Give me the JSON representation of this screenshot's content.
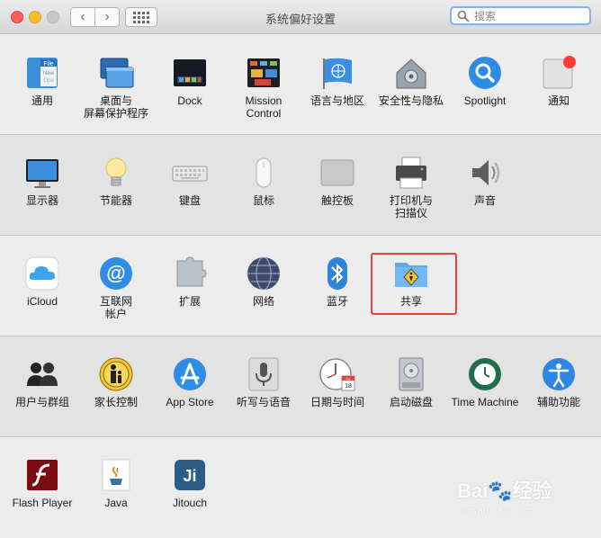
{
  "window": {
    "title": "系统偏好设置"
  },
  "search": {
    "placeholder": "搜索",
    "value": ""
  },
  "rows": [
    {
      "items": [
        {
          "label": "通用",
          "icon": "general-icon"
        },
        {
          "label": "桌面与\n屏幕保护程序",
          "icon": "desktop-screensaver-icon"
        },
        {
          "label": "Dock",
          "icon": "dock-icon"
        },
        {
          "label": "Mission\nControl",
          "icon": "mission-control-icon"
        },
        {
          "label": "语言与地区",
          "icon": "language-region-icon"
        },
        {
          "label": "安全性与隐私",
          "icon": "security-privacy-icon"
        },
        {
          "label": "Spotlight",
          "icon": "spotlight-icon"
        },
        {
          "label": "通知",
          "icon": "notifications-icon"
        }
      ]
    },
    {
      "items": [
        {
          "label": "显示器",
          "icon": "displays-icon"
        },
        {
          "label": "节能器",
          "icon": "energy-saver-icon"
        },
        {
          "label": "键盘",
          "icon": "keyboard-icon"
        },
        {
          "label": "鼠标",
          "icon": "mouse-icon"
        },
        {
          "label": "触控板",
          "icon": "trackpad-icon"
        },
        {
          "label": "打印机与\n扫描仪",
          "icon": "printers-scanners-icon"
        },
        {
          "label": "声音",
          "icon": "sound-icon"
        }
      ]
    },
    {
      "items": [
        {
          "label": "iCloud",
          "icon": "icloud-icon"
        },
        {
          "label": "互联网\n帐户",
          "icon": "internet-accounts-icon"
        },
        {
          "label": "扩展",
          "icon": "extensions-icon"
        },
        {
          "label": "网络",
          "icon": "network-icon"
        },
        {
          "label": "蓝牙",
          "icon": "bluetooth-icon"
        },
        {
          "label": "共享",
          "icon": "sharing-icon"
        }
      ]
    },
    {
      "items": [
        {
          "label": "用户与群组",
          "icon": "users-groups-icon"
        },
        {
          "label": "家长控制",
          "icon": "parental-controls-icon"
        },
        {
          "label": "App Store",
          "icon": "app-store-icon"
        },
        {
          "label": "听写与语音",
          "icon": "dictation-speech-icon"
        },
        {
          "label": "日期与时间",
          "icon": "date-time-icon"
        },
        {
          "label": "启动磁盘",
          "icon": "startup-disk-icon"
        },
        {
          "label": "Time Machine",
          "icon": "time-machine-icon"
        },
        {
          "label": "辅助功能",
          "icon": "accessibility-icon"
        }
      ]
    },
    {
      "items": [
        {
          "label": "Flash Player",
          "icon": "flash-player-icon"
        },
        {
          "label": "Java",
          "icon": "java-icon"
        },
        {
          "label": "Jitouch",
          "icon": "jitouch-icon"
        }
      ]
    }
  ],
  "icon_text": {
    "general_file": "File",
    "general_new": "New",
    "general_open": "Ope",
    "calendar_month": "JUL",
    "calendar_day": "18",
    "jitouch_text": "Ji"
  },
  "watermark": {
    "brand": "Bai",
    "brand2": "经验",
    "sub": "jingyan.baidu.com"
  },
  "colors": {
    "highlight": "#e0443b",
    "search_focus": "#7eb3f6",
    "notification_badge": "#fc3d39"
  }
}
